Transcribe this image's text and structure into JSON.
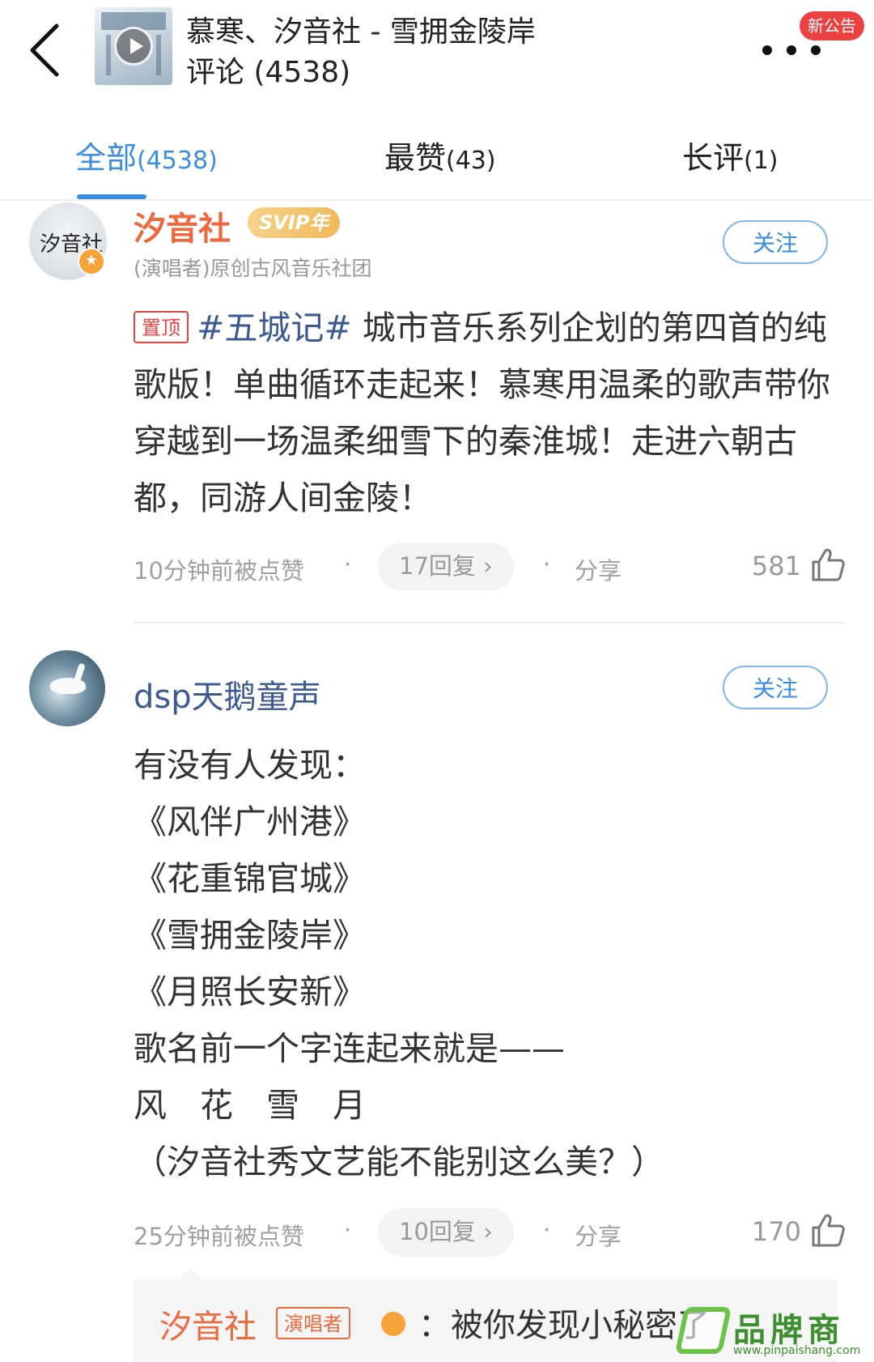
{
  "header": {
    "song_title": "慕寒、汐音社 - 雪拥金陵岸",
    "comment_title": "评论 (4538)",
    "new_notice": "新公告"
  },
  "tabs": [
    {
      "label": "全部",
      "count": "(4538)",
      "active": true
    },
    {
      "label": "最赞",
      "count": "(43)",
      "active": false
    },
    {
      "label": "长评",
      "count": "(1)",
      "active": false
    }
  ],
  "comments": [
    {
      "username": "汐音社",
      "badge": "SVIP年",
      "subtitle": "(演唱者)原创古风音乐社团",
      "follow_label": "关注",
      "pin_tag": "置顶",
      "topic": "#五城记#",
      "text": " 城市音乐系列企划的第四首的纯歌版！单曲循环走起来！慕寒用温柔的歌声带你穿越到一场温柔细雪下的秦淮城！走进六朝古都，同游人间金陵！",
      "time": "10分钟前被点赞",
      "replies": "17回复 ›",
      "share": "分享",
      "likes": "581"
    },
    {
      "username": "dsp天鹅童声",
      "follow_label": "关注",
      "lines": [
        "有没有人发现：",
        "《风伴广州港》",
        "《花重锦官城》",
        "《雪拥金陵岸》",
        "《月照长安新》",
        "歌名前一个字连起来就是——",
        "风　花　雪　月",
        "（汐音社秀文艺能不能别这么美？）"
      ],
      "time": "25分钟前被点赞",
      "replies": "10回复 ›",
      "share": "分享",
      "likes": "170",
      "reply_preview": {
        "username": "汐音社",
        "tag": "演唱者",
        "text": "：被你发现小秘密了"
      }
    }
  ],
  "separator": "·",
  "watermark": {
    "text": "品牌商",
    "url": "www.pinpaishang.com"
  },
  "colors": {
    "accent": "#3a8de0",
    "singer_orange": "#ec6a3e",
    "pin_red": "#ec4141",
    "username_blue": "#3c5a8f"
  }
}
